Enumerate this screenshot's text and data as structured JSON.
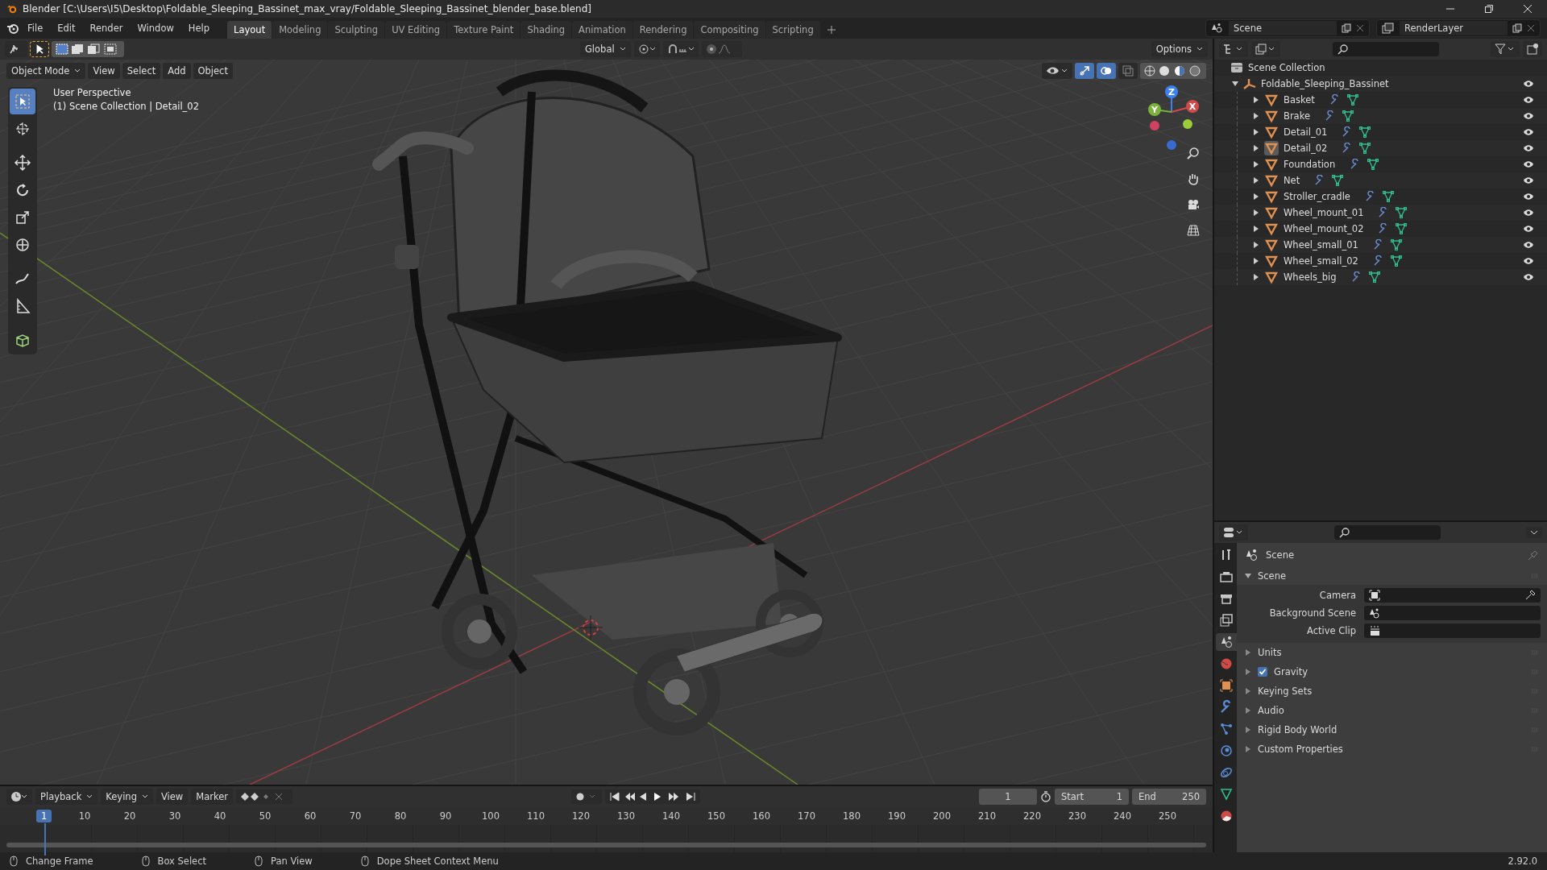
{
  "window": {
    "title": "Blender [C:\\Users\\I5\\Desktop\\Foldable_Sleeping_Bassinet_max_vray/Foldable_Sleeping_Bassinet_blender_base.blend]"
  },
  "menu": [
    "File",
    "Edit",
    "Render",
    "Window",
    "Help"
  ],
  "workspaces": [
    {
      "label": "Layout",
      "selected": true
    },
    {
      "label": "Modeling",
      "selected": false
    },
    {
      "label": "Sculpting",
      "selected": false
    },
    {
      "label": "UV Editing",
      "selected": false
    },
    {
      "label": "Texture Paint",
      "selected": false
    },
    {
      "label": "Shading",
      "selected": false
    },
    {
      "label": "Animation",
      "selected": false
    },
    {
      "label": "Rendering",
      "selected": false
    },
    {
      "label": "Compositing",
      "selected": false
    },
    {
      "label": "Scripting",
      "selected": false
    }
  ],
  "scene_field": {
    "value": "Scene"
  },
  "view_layer_field": {
    "value": "RenderLayer"
  },
  "viewport": {
    "orientation": "Global",
    "options": "Options",
    "mode": "Object Mode",
    "menus": [
      "View",
      "Select",
      "Add",
      "Object"
    ],
    "overlay_lines": [
      "User Perspective",
      "(1) Scene Collection | Detail_02"
    ],
    "gizmo": [
      "Z",
      "Y",
      "X"
    ]
  },
  "outliner": {
    "root": "Scene Collection",
    "collection": {
      "name": "Foldable_Sleeping_Bassinet",
      "expanded": true,
      "children": [
        {
          "name": "Basket",
          "selected": false
        },
        {
          "name": "Brake",
          "selected": false
        },
        {
          "name": "Detail_01",
          "selected": false
        },
        {
          "name": "Detail_02",
          "selected": true
        },
        {
          "name": "Foundation",
          "selected": false
        },
        {
          "name": "Net",
          "selected": false
        },
        {
          "name": "Stroller_cradle",
          "selected": false
        },
        {
          "name": "Wheel_mount_01",
          "selected": false
        },
        {
          "name": "Wheel_mount_02",
          "selected": false
        },
        {
          "name": "Wheel_small_01",
          "selected": false
        },
        {
          "name": "Wheel_small_02",
          "selected": false
        },
        {
          "name": "Wheels_big",
          "selected": false
        }
      ]
    }
  },
  "properties": {
    "context": "Scene",
    "tabs": [
      {
        "kind": "tool",
        "selected": false
      },
      {
        "kind": "render",
        "selected": false
      },
      {
        "kind": "output",
        "selected": false
      },
      {
        "kind": "view_layer",
        "selected": false
      },
      {
        "kind": "scene",
        "selected": true
      },
      {
        "kind": "world",
        "selected": false
      },
      {
        "kind": "object",
        "selected": false
      },
      {
        "kind": "modifiers",
        "selected": false
      },
      {
        "kind": "particles",
        "selected": false
      },
      {
        "kind": "physics",
        "selected": false
      },
      {
        "kind": "constraints",
        "selected": false
      },
      {
        "kind": "data",
        "selected": false
      },
      {
        "kind": "material",
        "selected": false
      }
    ],
    "panel": {
      "title": "Scene",
      "expanded": true,
      "fields": [
        {
          "label": "Camera"
        },
        {
          "label": "Background Scene"
        },
        {
          "label": "Active Clip"
        }
      ]
    },
    "subpanels": [
      {
        "kind": "section",
        "label": "Units"
      },
      {
        "kind": "checkbox",
        "label": "Gravity",
        "checked": true
      },
      {
        "kind": "section",
        "label": "Keying Sets"
      },
      {
        "kind": "section",
        "label": "Audio"
      },
      {
        "kind": "section",
        "label": "Rigid Body World"
      },
      {
        "kind": "section",
        "label": "Custom Properties"
      }
    ]
  },
  "timeline": {
    "menus": [
      "Playback",
      "Keying",
      "View",
      "Marker"
    ],
    "current_frame": "1",
    "start_label": "Start",
    "start": "1",
    "end_label": "End",
    "end": "250",
    "playhead": "1",
    "ruler": [
      "10",
      "20",
      "30",
      "40",
      "50",
      "60",
      "70",
      "80",
      "90",
      "100",
      "110",
      "120",
      "130",
      "140",
      "150",
      "160",
      "170",
      "180",
      "190",
      "200",
      "210",
      "220",
      "230",
      "240",
      "250"
    ]
  },
  "status_bar": {
    "hints": [
      "Change Frame",
      "Box Select",
      "Pan View",
      "Dope Sheet Context Menu"
    ],
    "version": "2.92.0"
  }
}
